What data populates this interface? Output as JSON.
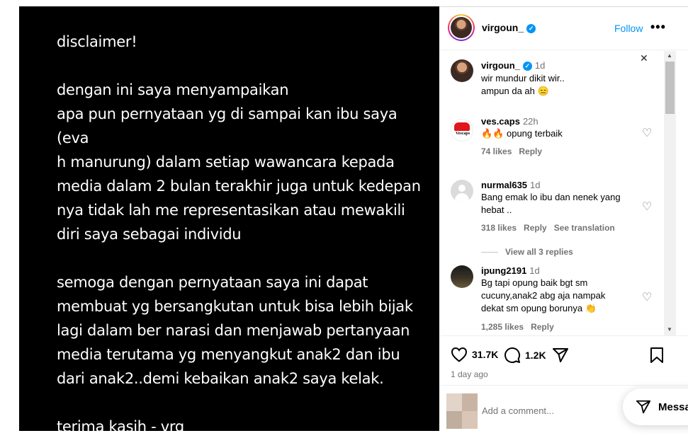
{
  "post": {
    "text": "disclaimer!\n\ndengan ini saya menyampaikan\napa pun pernyataan yg di sampai kan ibu saya (eva\nh manurung) dalam setiap wawancara kepada\nmedia dalam 2 bulan terakhir juga untuk kedepan\nnya tidak lah me representasikan atau mewakili\ndiri saya sebagai individu\n\nsemoga dengan pernyataan saya ini dapat\nmembuat yg bersangkutan untuk bisa lebih bijak\nlagi dalam ber narasi dan menjawab pertanyaan\nmedia terutama yg menyangkut anak2 dan ibu\ndari anak2..demi kebaikan anak2 saya kelak.\n\nterima kasih - vrg"
  },
  "header": {
    "username": "virgoun_",
    "verified_icon": "verified-badge-icon",
    "follow_label": "Follow",
    "more_icon": "more-options-icon"
  },
  "comments": [
    {
      "username": "virgoun_",
      "time": "1d",
      "text": "wir mundur dikit wir..\nampun da ah 😑"
    },
    {
      "username": "ves.caps",
      "time": "22h",
      "text": "🔥🔥 opung terbaik",
      "likes": "74 likes",
      "reply": "Reply"
    },
    {
      "username": "nurmal635",
      "time": "1d",
      "text": "Bang emak lo ibu dan nenek yang\nhebat ..",
      "likes": "318 likes",
      "reply": "Reply",
      "translation": "See translation",
      "view_replies": "View all 3 replies"
    },
    {
      "username": "ipung2191",
      "time": "1d",
      "text": "Bg tapi opung baik bgt sm\ncucuny,anak2 abg aja nampak\ndekat sm opung borunya 👏",
      "likes": "1,285 likes",
      "reply": "Reply"
    }
  ],
  "actions": {
    "like_count": "31.7K",
    "comment_count": "1.2K",
    "posted_ago": "1 day ago"
  },
  "add_comment": {
    "placeholder": "Add a comment..."
  },
  "messages": {
    "label": "Messa"
  },
  "colors": {
    "accent": "#0095f6",
    "muted": "#737373"
  }
}
